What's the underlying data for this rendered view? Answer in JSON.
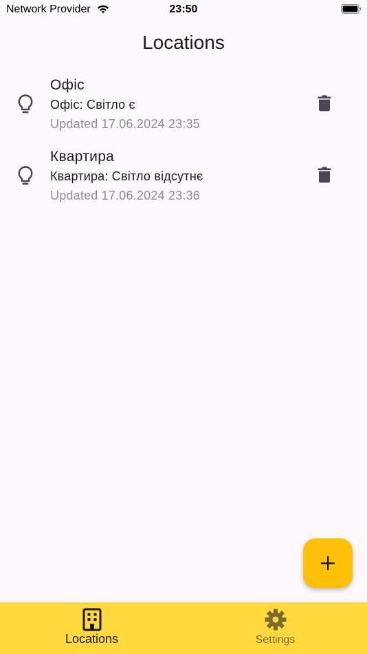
{
  "status_bar": {
    "carrier": "Network Provider",
    "time": "23:50"
  },
  "header": {
    "title": "Locations"
  },
  "locations": [
    {
      "title": "Офіс",
      "status": "Офіс: Світло є",
      "updated": "Updated 17.06.2024 23:35"
    },
    {
      "title": "Квартира",
      "status": "Квартира: Світло відсутнє",
      "updated": "Updated 17.06.2024 23:36"
    }
  ],
  "bottom_nav": {
    "items": [
      {
        "label": "Locations",
        "icon": "building-icon",
        "selected": true
      },
      {
        "label": "Settings",
        "icon": "gear-icon",
        "selected": false
      }
    ]
  },
  "colors": {
    "background": "#fdf8fc",
    "nav_background": "#ffd93d",
    "fab_background": "#ffc107",
    "text_primary": "#1d1b20",
    "text_secondary": "#8e8b92",
    "icon_dark": "#4a4453"
  }
}
